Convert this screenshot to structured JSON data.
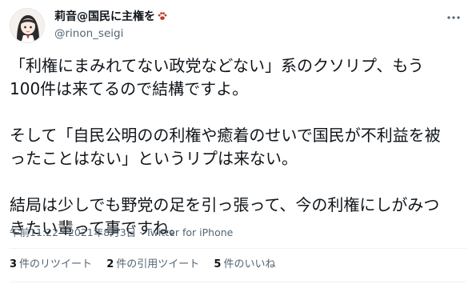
{
  "author": {
    "display_name": "莉音@国民に主権を",
    "handle": "@rinon_seigi",
    "avatar_icon": "anime-girl-avatar",
    "badge_icon": "paw-icon"
  },
  "tweet": {
    "paragraphs": [
      [
        "「利権にまみれてない政党などない」系のクソリプ、もう",
        "100件は来てるので結構ですよ。"
      ],
      [
        "そして「自民公明のの利権や癒着のせいで国民が不利益を被",
        "ったことはない」というリプは来ない。"
      ],
      [
        "結局は少しでも野党の足を引っ張って、今の利権にしがみつ",
        "きたい輩って事ですね。"
      ]
    ],
    "time": "午前11:22",
    "date": "2021年8月3日",
    "separator": "·",
    "source": "Twitter for iPhone"
  },
  "stats": {
    "retweets": {
      "count": "3",
      "label": "件のリツイート"
    },
    "quotes": {
      "count": "2",
      "label": "件の引用ツイート"
    },
    "likes": {
      "count": "5",
      "label": "件のいいね"
    }
  },
  "colors": {
    "text": "#0f1419",
    "secondary": "#536471",
    "divider": "#eff3f4",
    "paw": "#c0392b"
  }
}
